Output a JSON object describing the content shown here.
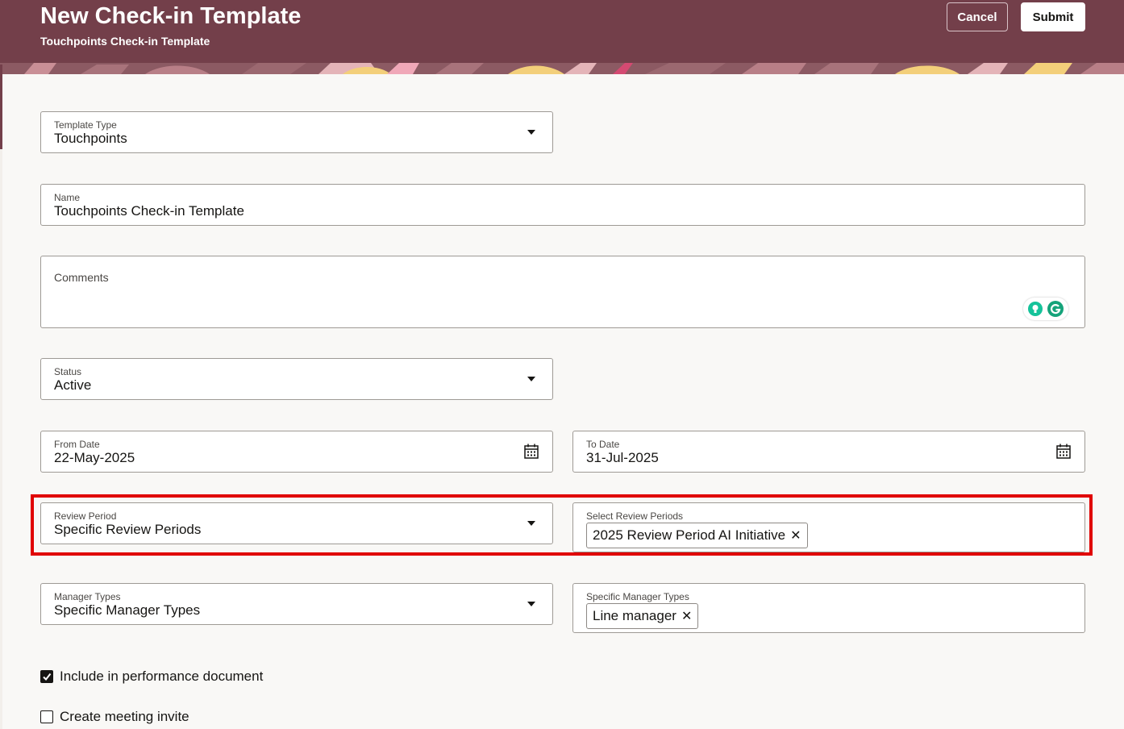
{
  "header": {
    "title": "New Check-in Template",
    "subtitle": "Touchpoints Check-in Template",
    "cancel_label": "Cancel",
    "submit_label": "Submit"
  },
  "form": {
    "template_type": {
      "label": "Template Type",
      "value": "Touchpoints"
    },
    "name": {
      "label": "Name",
      "value": "Touchpoints Check-in Template"
    },
    "comments": {
      "label": "Comments",
      "value": ""
    },
    "status": {
      "label": "Status",
      "value": "Active"
    },
    "from_date": {
      "label": "From Date",
      "value": "22-May-2025"
    },
    "to_date": {
      "label": "To Date",
      "value": "31-Jul-2025"
    },
    "review_period": {
      "label": "Review Period",
      "value": "Specific Review Periods"
    },
    "select_review_periods": {
      "label": "Select Review Periods",
      "chips": [
        "2025 Review Period AI Initiative"
      ]
    },
    "manager_types": {
      "label": "Manager Types",
      "value": "Specific Manager Types"
    },
    "specific_manager_types": {
      "label": "Specific Manager Types",
      "chips": [
        "Line manager"
      ]
    },
    "include_in_performance": {
      "label": "Include in performance document",
      "checked": true
    },
    "create_meeting_invite": {
      "label": "Create meeting invite",
      "checked": false
    }
  },
  "colors": {
    "header_bg": "#733f4a",
    "highlight": "#e00000",
    "grammarly_green": "#15c39a"
  }
}
